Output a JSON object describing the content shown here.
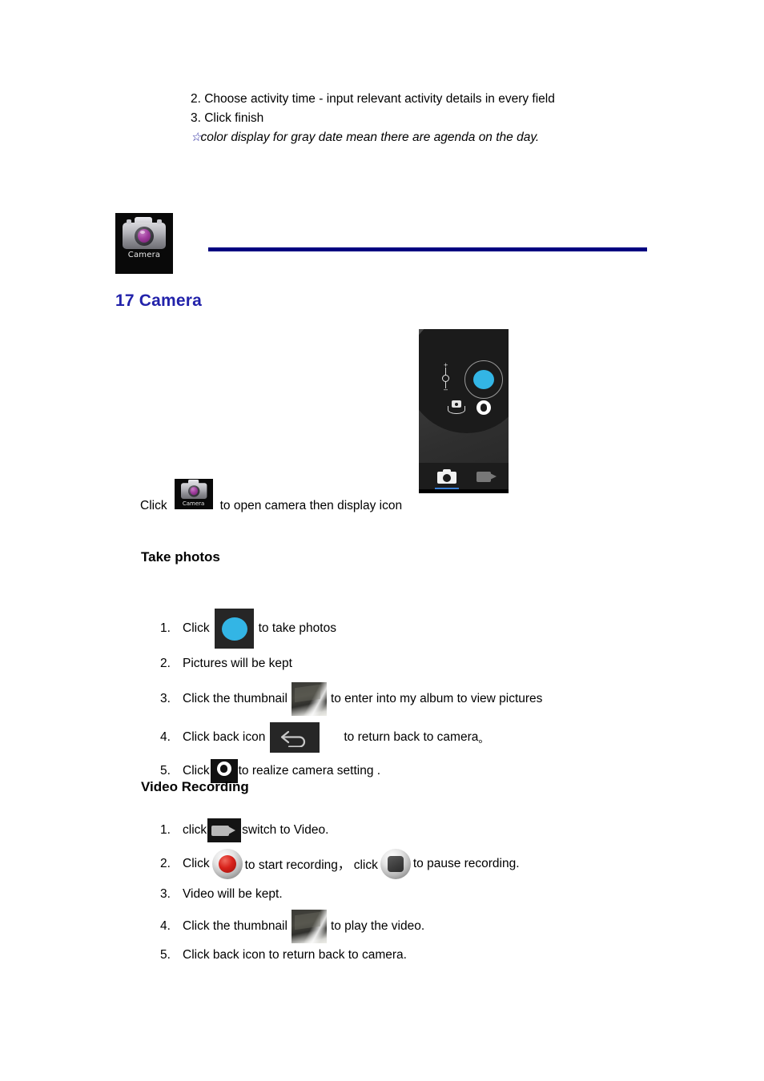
{
  "document": {
    "continuation_steps": [
      "2. Choose activity time - input relevant activity details in every field",
      "3. Click finish"
    ],
    "note_star": "☆",
    "note_text": "color display for gray date mean there are agenda on the day."
  },
  "app_icon": {
    "label": "Camera",
    "name": "camera-app-icon"
  },
  "section": {
    "heading": "17 Camera",
    "heading_color": "#2222aa",
    "rule_color": "#000080"
  },
  "open_line": {
    "prefix": "Click",
    "icon_label": "Camera",
    "suffix": "to open camera then display icon"
  },
  "phone_screenshot": {
    "shutter_color": "#33b5e5",
    "tab_active_underline_color": "#3b7fd4",
    "controls": [
      "zoom-slider",
      "switch-camera-icon",
      "settings-gear-icon",
      "shutter-button"
    ],
    "zoom_plus": "+",
    "zoom_minus": "–",
    "tabs": [
      {
        "name": "photo-mode-tab",
        "active": true
      },
      {
        "name": "video-mode-tab",
        "active": false
      }
    ]
  },
  "take_photos": {
    "heading": "Take photos",
    "steps": [
      {
        "num": "1.",
        "pre": "Click",
        "icon": "shutter-button-icon",
        "post": "to take photos"
      },
      {
        "num": "2.",
        "pre": "Pictures will be kept",
        "icon": null,
        "post": ""
      },
      {
        "num": "3.",
        "pre": "Click the thumbnail",
        "icon": "photo-thumbnail-icon",
        "post": "to enter into my album to view pictures"
      },
      {
        "num": "4.",
        "pre": "Click back icon",
        "icon": "back-arrow-icon",
        "post": "to return back to camera",
        "trailing": "。"
      },
      {
        "num": "5.",
        "pre": "Click",
        "icon": "camera-settings-icon",
        "post": "to realize camera setting ."
      }
    ]
  },
  "video_recording": {
    "heading": "Video Recording",
    "steps": [
      {
        "num": "1.",
        "pre": "click",
        "icon": "video-mode-icon",
        "post": "switch to Video."
      },
      {
        "num": "2.",
        "pre": "Click",
        "icon": "record-button-icon",
        "mid": "to start recording， click",
        "icon2": "pause-button-icon",
        "post": "to pause recording."
      },
      {
        "num": "3.",
        "pre": "Video will be kept.",
        "icon": null,
        "post": ""
      },
      {
        "num": "4.",
        "pre": "Click the thumbnail",
        "icon": "video-thumbnail-icon",
        "post": "to play the video."
      },
      {
        "num": "5.",
        "pre": "Click back icon to return back to camera.",
        "icon": null,
        "post": ""
      }
    ]
  }
}
